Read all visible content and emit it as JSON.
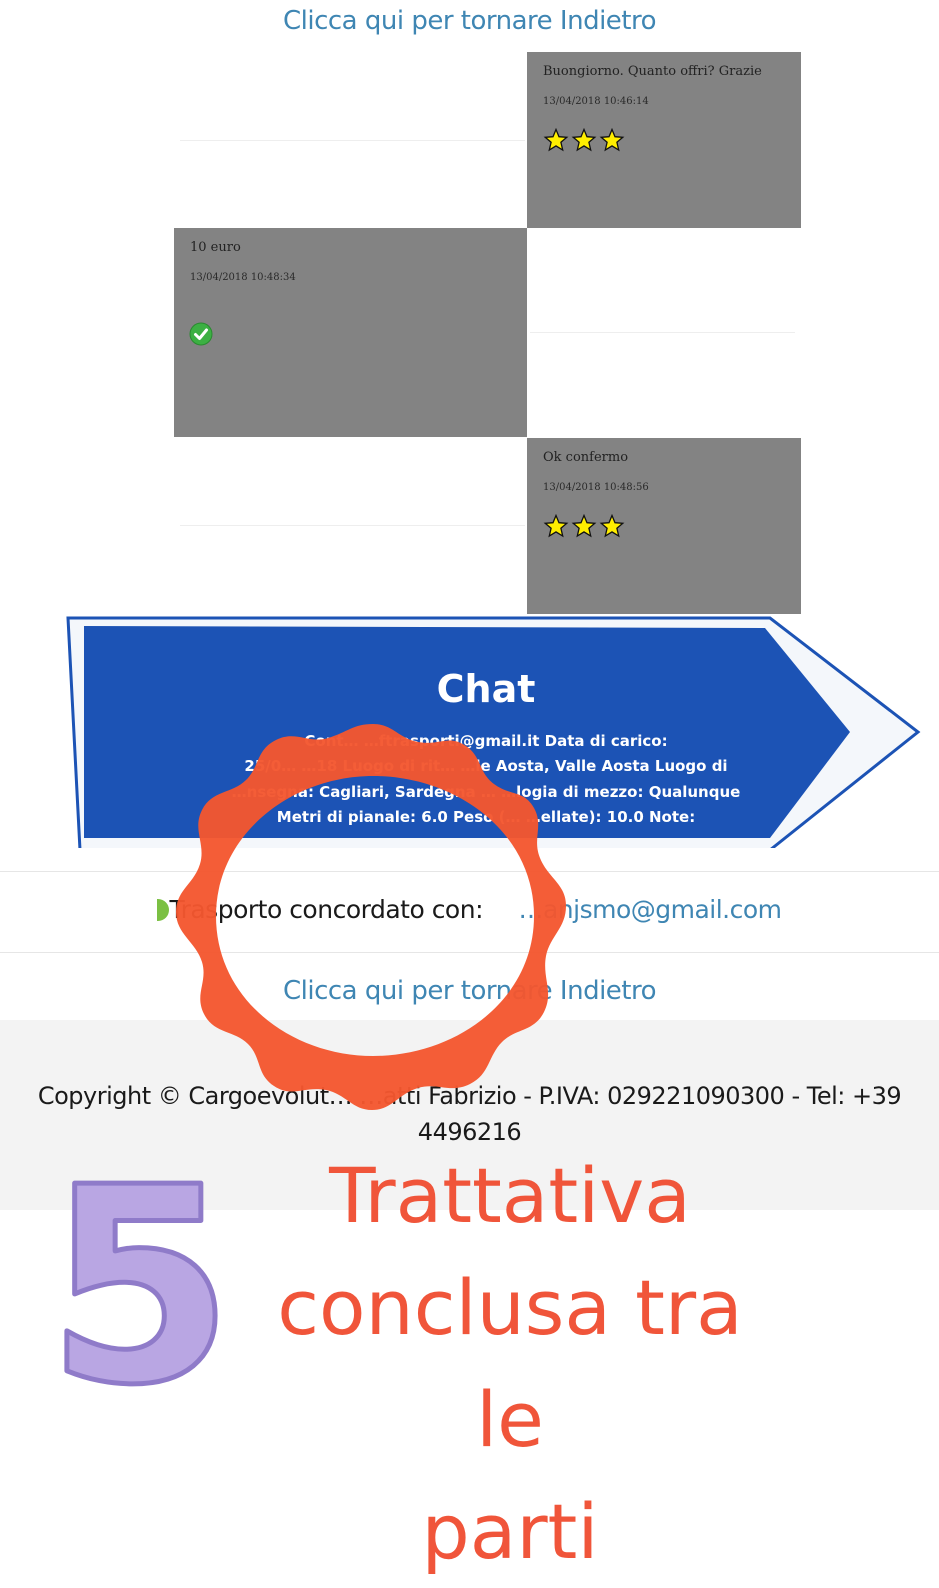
{
  "nav": {
    "back_link_top": "Clicca qui per tornare Indietro",
    "back_link_bottom": "Clicca qui per tornare Indietro"
  },
  "messages": [
    {
      "text": "Buongiorno. Quanto offri? Grazie",
      "time": "13/04/2018 10:46:14",
      "side": "right",
      "rating": 3
    },
    {
      "text": "10 euro",
      "time": "13/04/2018 10:48:34",
      "side": "left",
      "status": "check-icon"
    },
    {
      "text": "Ok confermo",
      "time": "13/04/2018 10:48:56",
      "side": "right",
      "rating": 3
    }
  ],
  "chat_sign": {
    "title": "Chat",
    "details_lines": [
      "Cont… …ftrasporti@gmail.it Data di carico:",
      "25/0… …18 Luogo di rit… …le Aosta, Valle Aosta Luogo di",
      "…nsegna: Cagliari, Sardegna … …logia di mezzo: Qualunque",
      "Metri di pianale: 6.0 Peso (… …ellate): 10.0 Note:"
    ]
  },
  "agreement": {
    "label": "Trasporto concordato con:",
    "email": "…anjsmo@gmail.com"
  },
  "footer": {
    "copyright_line1": "Copyright © Cargoevolut… …atti Fabrizio - P.IVA: 029221090300 - Tel: +39",
    "copyright_line2": "4496216"
  },
  "overlay": {
    "step_number": "5",
    "caption_lines": [
      "Trattativa",
      "conclusa tra le",
      "parti"
    ]
  },
  "colors": {
    "link": "#3f86b3",
    "message_bg": "#838383",
    "sign_blue": "#1c53b5",
    "annotation_red": "#f0553a",
    "number_purple": "#b9a6e3"
  }
}
